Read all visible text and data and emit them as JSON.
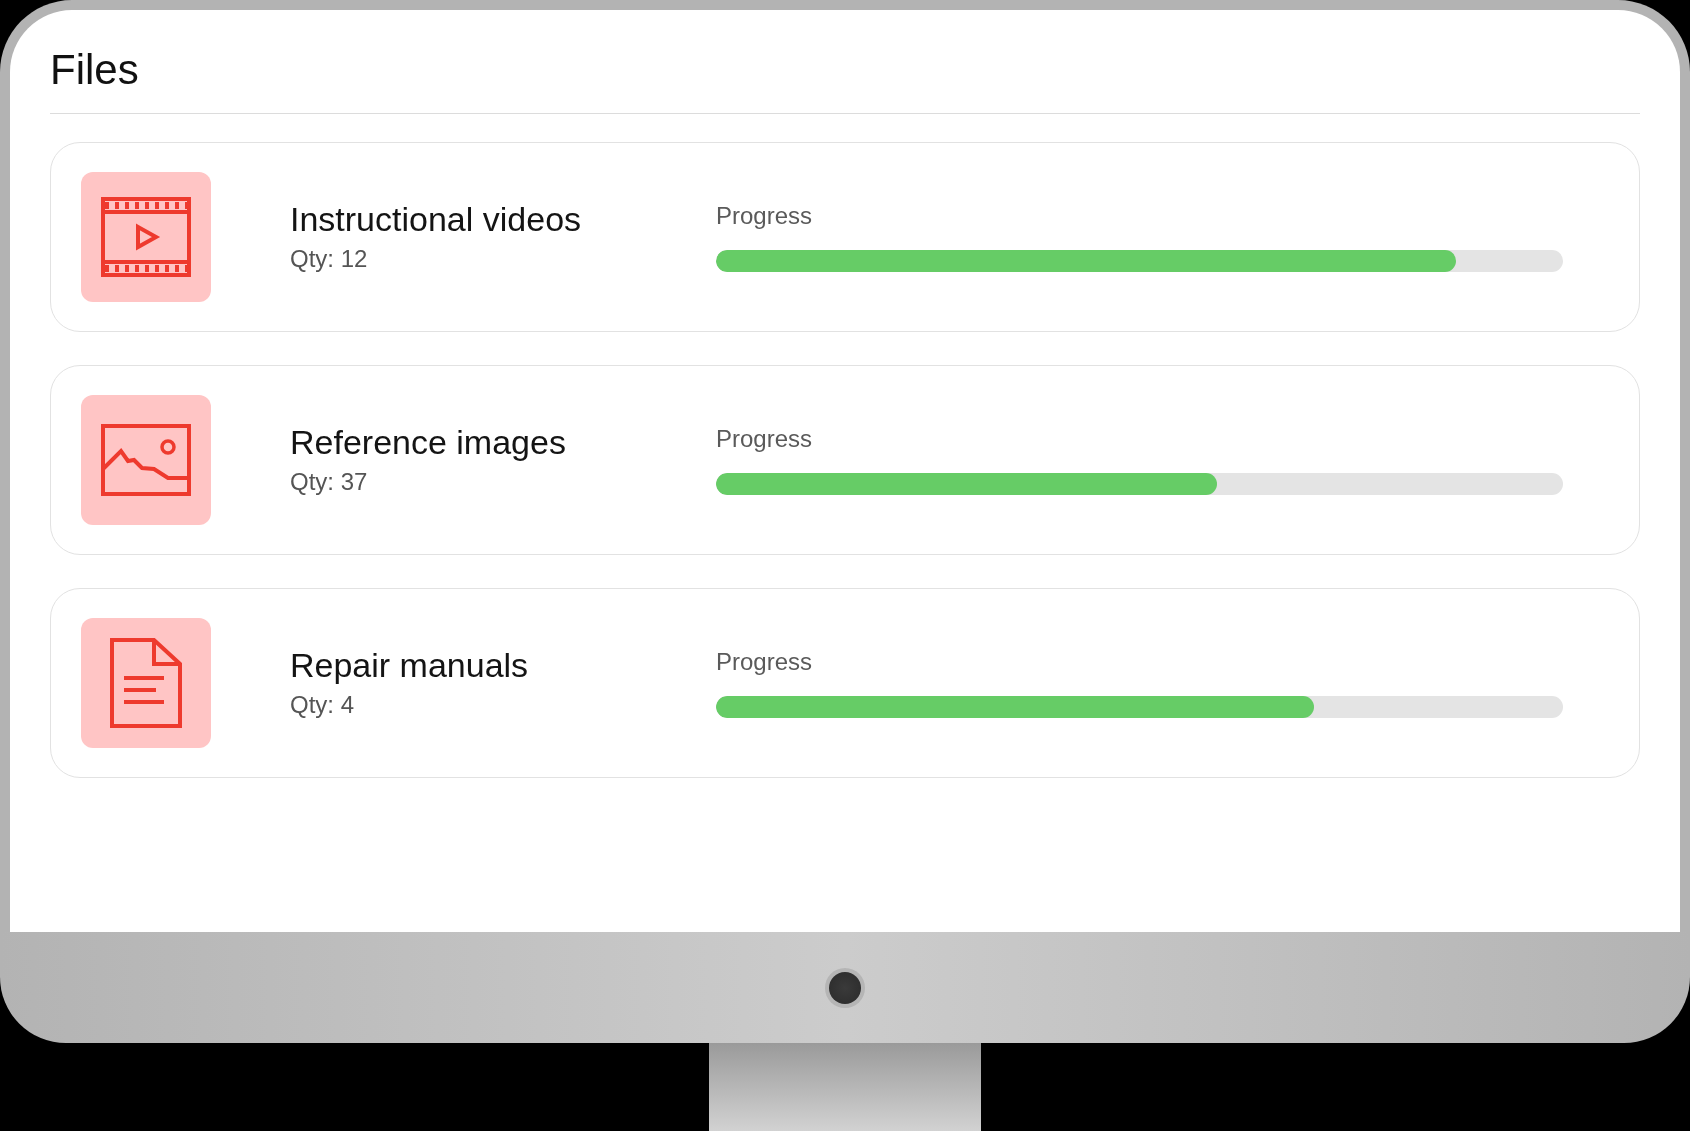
{
  "title": "Files",
  "files": [
    {
      "kind": "video",
      "name": "Instructional videos",
      "quantity": "Qty: 12",
      "progress_label": "Progress",
      "level": 0.874
    },
    {
      "kind": "image",
      "name": "Reference images",
      "quantity": "Qty: 37",
      "progress_label": "Progress",
      "level": 0.591
    },
    {
      "kind": "document",
      "name": "Repair manuals",
      "quantity": "Qty: 4",
      "progress_label": "Progress",
      "level": 0.706
    }
  ]
}
